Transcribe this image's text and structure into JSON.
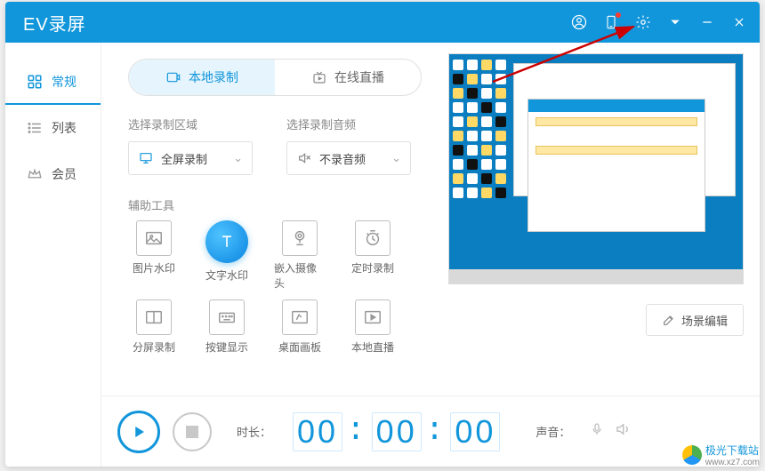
{
  "title": "EV录屏",
  "sidebar": {
    "items": [
      {
        "label": "常规"
      },
      {
        "label": "列表"
      },
      {
        "label": "会员"
      }
    ]
  },
  "tabs": {
    "local": "本地录制",
    "live": "在线直播"
  },
  "selectors": {
    "area_label": "选择录制区域",
    "area_value": "全屏录制",
    "audio_label": "选择录制音频",
    "audio_value": "不录音频"
  },
  "aux_label": "辅助工具",
  "tools": [
    {
      "label": "图片水印"
    },
    {
      "label": "文字水印"
    },
    {
      "label": "嵌入摄像头"
    },
    {
      "label": "定时录制"
    },
    {
      "label": "分屏录制"
    },
    {
      "label": "按键显示"
    },
    {
      "label": "桌面画板"
    },
    {
      "label": "本地直播"
    }
  ],
  "scene_edit": "场景编辑",
  "footer": {
    "duration_label": "时长：",
    "timer_h": "00",
    "timer_m": "00",
    "timer_s": "00",
    "sound_label": "声音："
  },
  "corner": {
    "name": "极光下载站",
    "url": "www.xz7.com"
  }
}
